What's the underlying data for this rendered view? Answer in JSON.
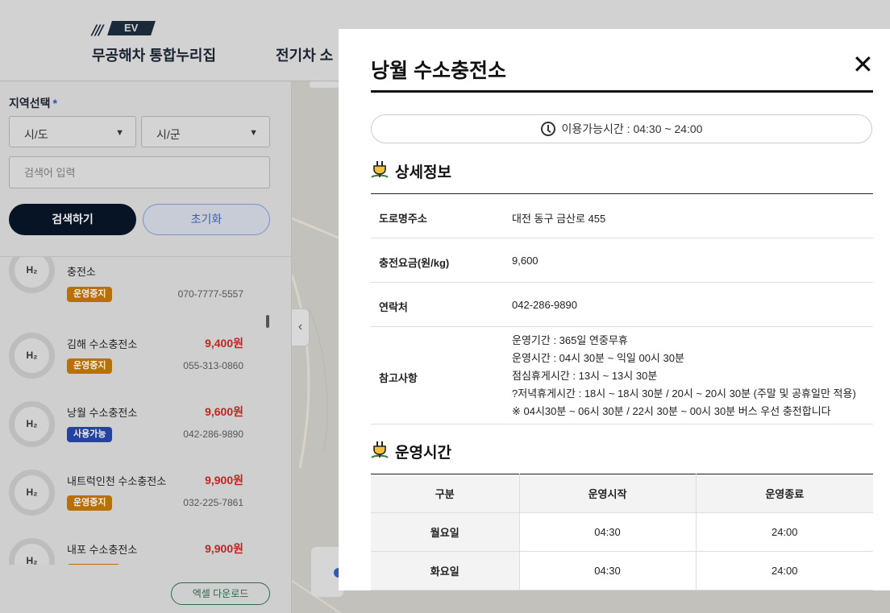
{
  "header": {
    "logo_text": "EV",
    "logo_stripes": "///",
    "site_title": "무공해차 통합누리집",
    "nav_item": "전기차 소"
  },
  "sidebar": {
    "region_label": "지역선택",
    "required_mark": "*",
    "sido_select": "시/도",
    "sigun_select": "시/군",
    "search_placeholder": "검색어 입력",
    "search_button": "검색하기",
    "reset_button": "초기화",
    "excel_button": "엑셀 다운로드",
    "stations": [
      {
        "icon_label": "H₂",
        "name": "충전소",
        "price": "",
        "status": "운영중지",
        "phone": "070-7777-5557"
      },
      {
        "icon_label": "H₂",
        "name": "김해 수소충전소",
        "price": "9,400원",
        "status": "운영중지",
        "phone": "055-313-0860"
      },
      {
        "icon_label": "H₂",
        "name": "낭월 수소충전소",
        "price": "9,600원",
        "status": "사용가능",
        "phone": "042-286-9890"
      },
      {
        "icon_label": "H₂",
        "name": "내트럭인천 수소충전소",
        "price": "9,900원",
        "status": "운영중지",
        "phone": "032-225-7861"
      },
      {
        "icon_label": "H₂",
        "name": "내포 수소충전소",
        "price": "9,900원",
        "status": "",
        "phone": ""
      }
    ]
  },
  "map": {
    "collapse_glyph": "‹"
  },
  "modal": {
    "title": "낭월 수소충전소",
    "close_glyph": "✕",
    "hours": "이용가능시간 : 04:30 ~ 24:00",
    "detail_heading": "상세정보",
    "details": [
      {
        "label": "도로명주소",
        "value": "대전 동구 금산로 455"
      },
      {
        "label": "충전요금(원/kg)",
        "value": "9,600"
      },
      {
        "label": "연락처",
        "value": "042-286-9890"
      }
    ],
    "notes_label": "참고사항",
    "notes": [
      "운영기간 : 365일 연중무휴",
      "운영시간 : 04시 30분 ~ 익일 00시 30분",
      "점심휴게시간 : 13시 ~ 13시 30분",
      "?저녁휴게시간 : 18시 ~ 18시 30분 / 20시 ~ 20시 30분 (주말 및 공휴일만 적용)",
      "※ 04시30분 ~ 06시 30분 / 22시 30분 ~ 00시 30분 버스 우선 충전합니다"
    ],
    "op_heading": "운영시간",
    "op_table": {
      "headers": [
        "구분",
        "운영시작",
        "운영종료"
      ],
      "rows": [
        [
          "월요일",
          "04:30",
          "24:00"
        ],
        [
          "화요일",
          "04:30",
          "24:00"
        ]
      ]
    }
  }
}
